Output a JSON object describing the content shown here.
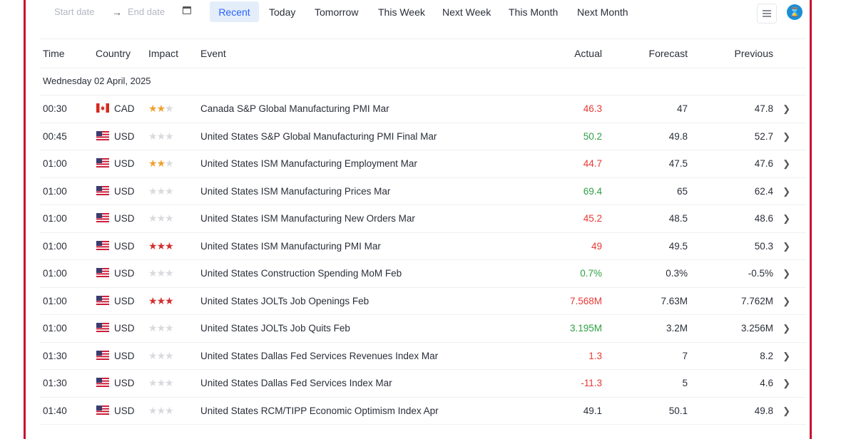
{
  "toolbar": {
    "start_date_placeholder": "Start date",
    "end_date_placeholder": "End date",
    "ranges": [
      "Recent",
      "Today",
      "Tomorrow",
      "This Week",
      "Next Week",
      "This Month",
      "Next Month"
    ],
    "active_range": "Recent"
  },
  "table": {
    "headers": {
      "time": "Time",
      "country": "Country",
      "impact": "Impact",
      "event": "Event",
      "actual": "Actual",
      "forecast": "Forecast",
      "previous": "Previous"
    },
    "date_label": "Wednesday 02 April, 2025",
    "rows": [
      {
        "time": "00:30",
        "flag": "CA",
        "currency": "CAD",
        "impact": 2,
        "event": "Canada S&P Global Manufacturing PMI Mar",
        "actual": "46.3",
        "actual_status": "red",
        "forecast": "47",
        "previous": "47.8"
      },
      {
        "time": "00:45",
        "flag": "US",
        "currency": "USD",
        "impact": 1,
        "event": "United States S&P Global Manufacturing PMI Final Mar",
        "actual": "50.2",
        "actual_status": "green",
        "forecast": "49.8",
        "previous": "52.7"
      },
      {
        "time": "01:00",
        "flag": "US",
        "currency": "USD",
        "impact": 2,
        "event": "United States ISM Manufacturing Employment Mar",
        "actual": "44.7",
        "actual_status": "red",
        "forecast": "47.5",
        "previous": "47.6"
      },
      {
        "time": "01:00",
        "flag": "US",
        "currency": "USD",
        "impact": 1,
        "event": "United States ISM Manufacturing Prices Mar",
        "actual": "69.4",
        "actual_status": "green",
        "forecast": "65",
        "previous": "62.4"
      },
      {
        "time": "01:00",
        "flag": "US",
        "currency": "USD",
        "impact": 1,
        "event": "United States ISM Manufacturing New Orders Mar",
        "actual": "45.2",
        "actual_status": "red",
        "forecast": "48.5",
        "previous": "48.6"
      },
      {
        "time": "01:00",
        "flag": "US",
        "currency": "USD",
        "impact": 3,
        "event": "United States ISM Manufacturing PMI Mar",
        "actual": "49",
        "actual_status": "red",
        "forecast": "49.5",
        "previous": "50.3"
      },
      {
        "time": "01:00",
        "flag": "US",
        "currency": "USD",
        "impact": 1,
        "event": "United States Construction Spending MoM Feb",
        "actual": "0.7%",
        "actual_status": "green",
        "forecast": "0.3%",
        "previous": "-0.5%"
      },
      {
        "time": "01:00",
        "flag": "US",
        "currency": "USD",
        "impact": 3,
        "event": "United States JOLTs Job Openings Feb",
        "actual": "7.568M",
        "actual_status": "red",
        "forecast": "7.63M",
        "previous": "7.762M"
      },
      {
        "time": "01:00",
        "flag": "US",
        "currency": "USD",
        "impact": 1,
        "event": "United States JOLTs Job Quits Feb",
        "actual": "3.195M",
        "actual_status": "green",
        "forecast": "3.2M",
        "previous": "3.256M"
      },
      {
        "time": "01:30",
        "flag": "US",
        "currency": "USD",
        "impact": 1,
        "event": "United States Dallas Fed Services Revenues Index Mar",
        "actual": "1.3",
        "actual_status": "red",
        "forecast": "7",
        "previous": "8.2"
      },
      {
        "time": "01:30",
        "flag": "US",
        "currency": "USD",
        "impact": 1,
        "event": "United States Dallas Fed Services Index Mar",
        "actual": "-11.3",
        "actual_status": "red",
        "forecast": "5",
        "previous": "4.6"
      },
      {
        "time": "01:40",
        "flag": "US",
        "currency": "USD",
        "impact": 1,
        "event": "United States RCM/TIPP Economic Optimism Index Apr",
        "actual": "49.1",
        "actual_status": "neutral",
        "forecast": "50.1",
        "previous": "49.8"
      }
    ]
  },
  "icons": {
    "calendar": "calendar-icon",
    "arrow": "arrow-right-icon",
    "settings": "filter-settings-icon",
    "logo": "hourglass-logo-icon",
    "chevron": "chevron-right-icon"
  },
  "colors": {
    "frame": "#c8102e",
    "active_chip": "#e3eefa",
    "active_text": "#2962ff",
    "negative": "#e53935",
    "positive": "#2ea043",
    "impact_medium": "#f0a030",
    "impact_high": "#d32f2f"
  }
}
